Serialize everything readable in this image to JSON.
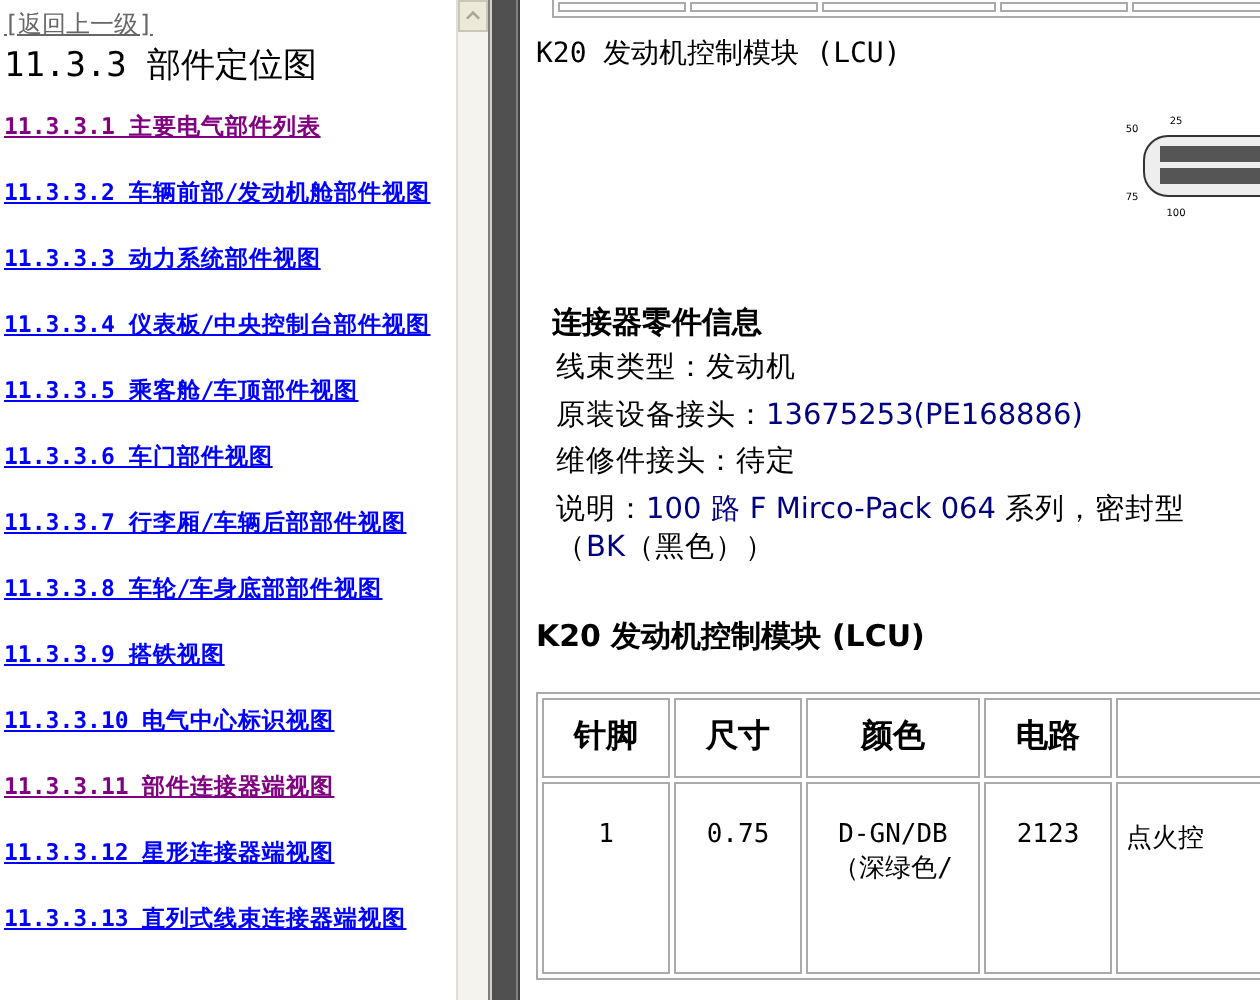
{
  "nav": {
    "back_link": "[返回上一级]",
    "title": "11.3.3 部件定位图",
    "links": [
      {
        "label": "11.3.3.1 主要电气部件列表",
        "visited": true
      },
      {
        "label": "11.3.3.2 车辆前部/发动机舱部件视图",
        "visited": false
      },
      {
        "label": "11.3.3.3 动力系统部件视图",
        "visited": false
      },
      {
        "label": "11.3.3.4 仪表板/中央控制台部件视图",
        "visited": false
      },
      {
        "label": "11.3.3.5 乘客舱/车顶部件视图",
        "visited": false
      },
      {
        "label": "11.3.3.6 车门部件视图",
        "visited": false
      },
      {
        "label": "11.3.3.7 行李厢/车辆后部部件视图",
        "visited": false
      },
      {
        "label": "11.3.3.8 车轮/车身底部部件视图",
        "visited": false
      },
      {
        "label": "11.3.3.9 搭铁视图",
        "visited": false
      },
      {
        "label": "11.3.3.10 电气中心标识视图",
        "visited": false
      },
      {
        "label": "11.3.3.11 部件连接器端视图",
        "visited": true
      },
      {
        "label": "11.3.3.12 星形连接器端视图",
        "visited": false
      },
      {
        "label": "11.3.3.13 直列式线束连接器端视图",
        "visited": false
      }
    ]
  },
  "document": {
    "heading": "K20 发动机控制模块 (LCU)",
    "connector": {
      "pin_labels": [
        "25",
        "50",
        "75",
        "100"
      ]
    },
    "info_title": "连接器零件信息",
    "info_lines": [
      [
        {
          "text": "线束类型：发动机",
          "highlight": false
        }
      ],
      [
        {
          "text": "原装设备接头：",
          "highlight": false
        },
        {
          "text": "13675253(PE168886)",
          "highlight": true
        }
      ],
      [
        {
          "text": "维修件接头：待定",
          "highlight": false
        }
      ],
      [
        {
          "text": "说明：",
          "highlight": false
        },
        {
          "text": "100 路  F Mirco-Pack 064",
          "highlight": true
        },
        {
          "text": " 系列，密封型（",
          "highlight": false
        },
        {
          "text": "BK",
          "highlight": true
        },
        {
          "text": "（黑色））",
          "highlight": false
        }
      ]
    ],
    "table_title": "K20 发动机控制模块 (LCU)",
    "table": {
      "columns": [
        "针脚",
        "尺寸",
        "颜色",
        "电路",
        ""
      ],
      "rows": [
        [
          "1",
          "0.75",
          "D-GN/DB（深绿色/",
          "2123",
          "点火控"
        ]
      ]
    }
  }
}
